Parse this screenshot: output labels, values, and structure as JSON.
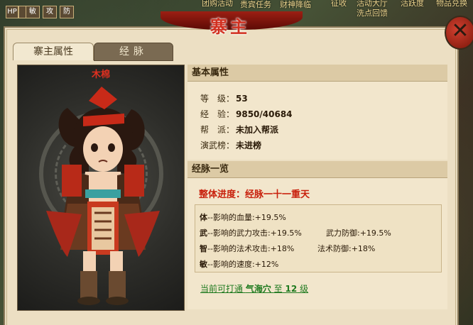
{
  "top_bar": {
    "icons": [
      "HP",
      "敏",
      "攻",
      "防"
    ],
    "links": [
      "团购活动",
      "贵宾任务",
      "财神降临",
      "征收",
      "活动大厅",
      "洗点回馈",
      "活跃度",
      "物品兑换"
    ]
  },
  "dialog": {
    "title": "寨主",
    "close_symbol": "✕",
    "tabs": [
      {
        "label": "寨主属性",
        "active": true
      },
      {
        "label": "经脉",
        "active": false
      }
    ]
  },
  "character": {
    "name": "木棉"
  },
  "basic_attributes": {
    "heading": "基本属性",
    "rows": [
      {
        "label": "等　级：",
        "value": "53"
      },
      {
        "label": "经　验：",
        "value": "9850/40684"
      },
      {
        "label": "帮　派：",
        "value": "未加入帮派"
      },
      {
        "label": "演武榜：",
        "value": "未进榜"
      }
    ]
  },
  "meridians": {
    "heading": "经脉一览",
    "progress_label": "整体进度：",
    "progress_value": "经脉一十一重天",
    "stats": [
      {
        "attr": "体",
        "text": "--影响的血量:",
        "value": "+19.5%"
      },
      {
        "attr": "武",
        "text": "--影响的武力攻击:",
        "value": "+19.5%"
      },
      {
        "attr": "",
        "text": "武力防御:",
        "value": "+19.5%"
      },
      {
        "attr": "智",
        "text": "--影响的法术攻击:",
        "value": "+18%"
      },
      {
        "attr": "",
        "text": "法术防御:",
        "value": "+18%"
      },
      {
        "attr": "敏",
        "text": "--影响的速度:",
        "value": "+12%"
      }
    ],
    "next_link": {
      "prefix": "当前可打通",
      "acupoint": "气海穴",
      "mid": "至",
      "level": "12",
      "suffix": "级"
    }
  },
  "colors": {
    "accent_red": "#c8200c",
    "link_green": "#1f7a1f",
    "panel_bg": "#ecdfc3"
  }
}
